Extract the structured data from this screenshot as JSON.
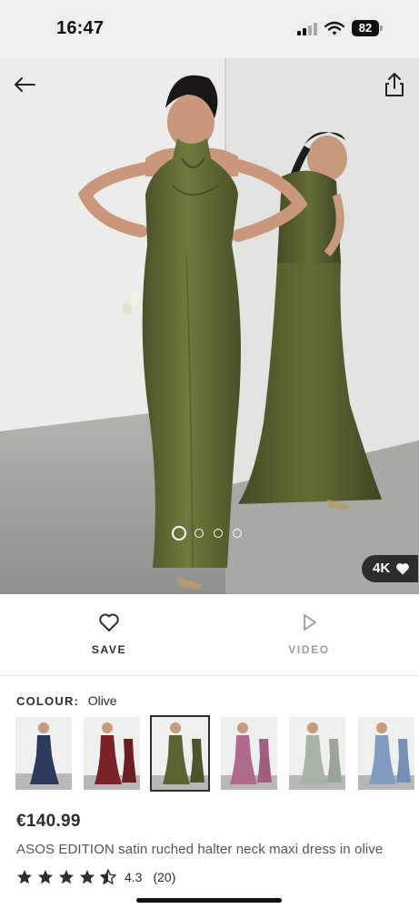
{
  "status_bar": {
    "time": "16:47",
    "battery": "82",
    "icons": [
      "signal-icon",
      "wifi-icon",
      "battery-icon"
    ]
  },
  "hero": {
    "icons": {
      "back": "back-arrow-icon",
      "share": "share-icon"
    },
    "carousel": {
      "count": 4,
      "active_index": 0
    },
    "badge_4k": {
      "label": "4K",
      "icon": "heart-icon"
    },
    "colors": {
      "dress": "#5b6331",
      "background": "#ebebea",
      "floor": "#9e9e9c"
    }
  },
  "actions": {
    "save_label": "SAVE",
    "video_label": "VIDEO"
  },
  "colour": {
    "label": "COLOUR:",
    "value": "Olive",
    "swatches": [
      {
        "name": "navy",
        "color": "#2c3a5e"
      },
      {
        "name": "burgundy",
        "color": "#7a2327"
      },
      {
        "name": "olive",
        "color": "#5b6331",
        "selected": true
      },
      {
        "name": "mauve",
        "color": "#b06a8e"
      },
      {
        "name": "sage",
        "color": "#a9b3a6"
      },
      {
        "name": "dusty-blue",
        "color": "#7f9cc0"
      }
    ]
  },
  "product": {
    "price": "€140.99",
    "title": "ASOS EDITION satin ruched halter neck maxi dress in olive",
    "rating_value": "4.3",
    "rating_count": "(20)",
    "stars": 4.3
  }
}
